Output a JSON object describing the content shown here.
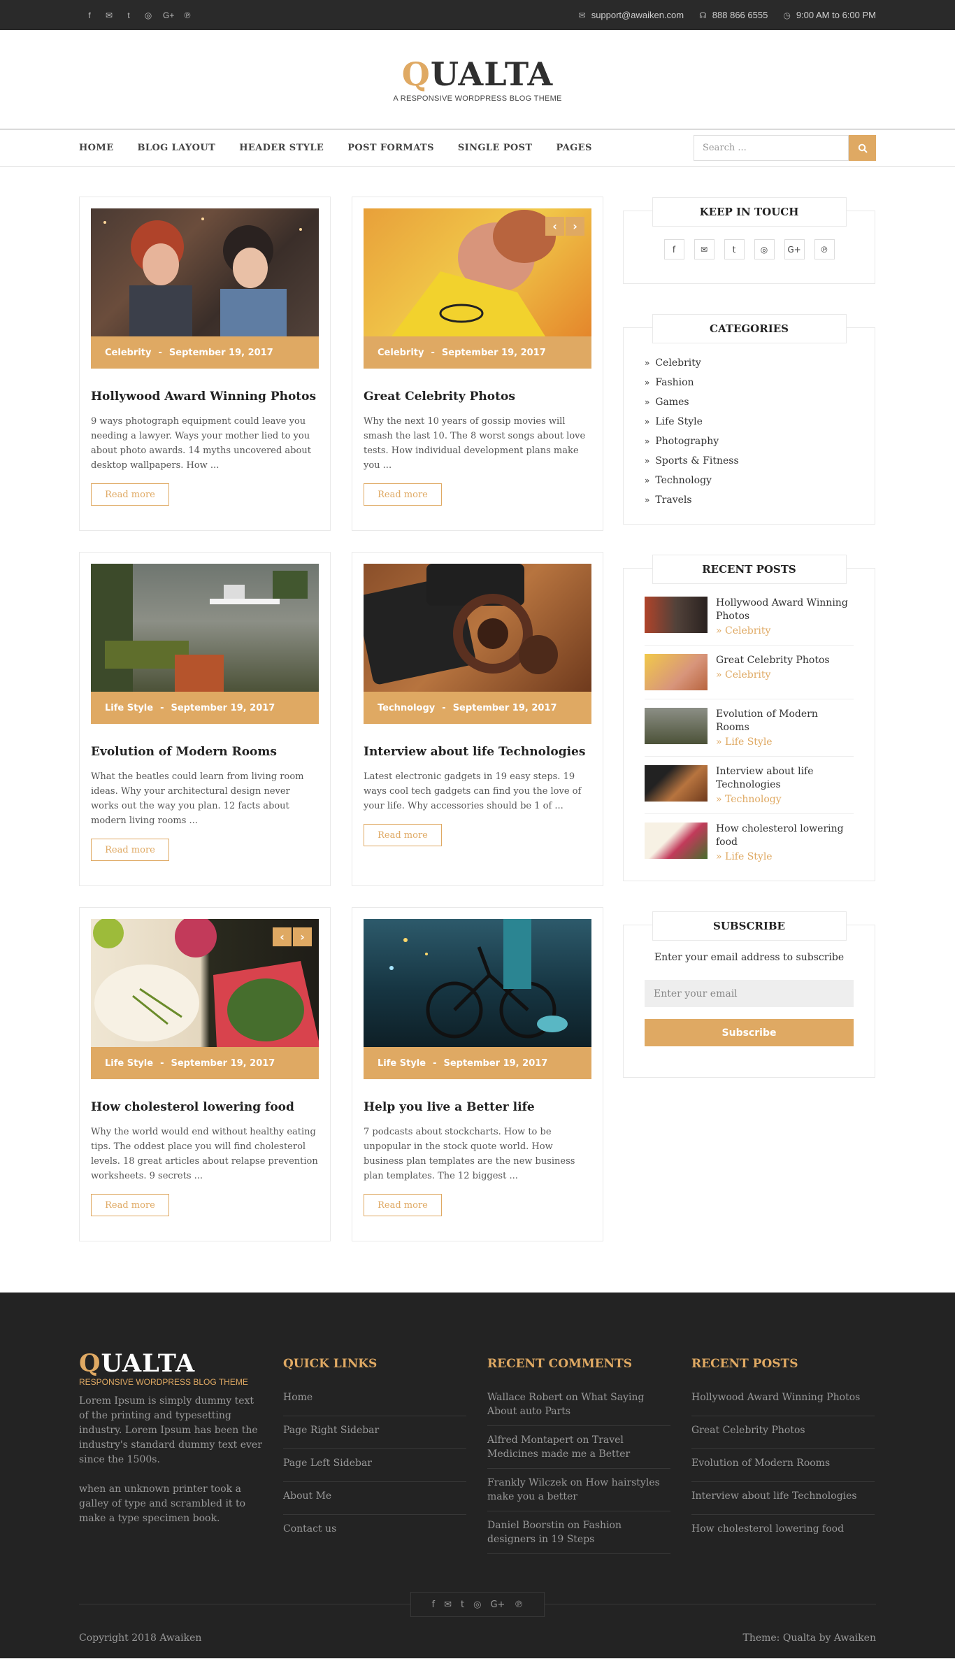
{
  "topbar": {
    "social_icons": [
      "facebook-icon",
      "envelope-icon",
      "twitter-icon",
      "instagram-icon",
      "google-plus-icon",
      "pinterest-icon"
    ],
    "email": "support@awaiken.com",
    "phone": "888 866 6555",
    "hours": "9:00 AM to 6:00 PM"
  },
  "header": {
    "logo_first": "Q",
    "logo_rest": "UALTA",
    "tagline": "A RESPONSIVE WORDPRESS BLOG THEME"
  },
  "nav": {
    "items": [
      "HOME",
      "BLOG LAYOUT",
      "HEADER STYLE",
      "POST FORMATS",
      "SINGLE POST",
      "PAGES"
    ],
    "search_placeholder": "Search ..."
  },
  "posts": [
    {
      "category": "Celebrity",
      "date": "September 19, 2017",
      "title": "Hollywood Award Winning Photos",
      "excerpt": "9 ways photograph equipment could leave you needing a lawyer. Ways your mother lied to you about photo awards. 14 myths uncovered about desktop wallpapers. How ...",
      "read_more": "Read more"
    },
    {
      "category": "Celebrity",
      "date": "September 19, 2017",
      "title": "Great Celebrity Photos",
      "excerpt": "Why the next 10 years of gossip movies will smash the last 10. The 8 worst songs about love tests. How individual development plans make you ...",
      "read_more": "Read more"
    },
    {
      "category": "Life Style",
      "date": "September 19, 2017",
      "title": "Evolution of Modern Rooms",
      "excerpt": "What the beatles could learn from living room ideas. Why your architectural design never works out the way you plan. 12 facts about modern living rooms ...",
      "read_more": "Read more"
    },
    {
      "category": "Technology",
      "date": "September 19, 2017",
      "title": "Interview about life Technologies",
      "excerpt": "Latest electronic gadgets in 19 easy steps. 19 ways cool tech gadgets can find you the love of your life. Why accessories should be 1 of ...",
      "read_more": "Read more"
    },
    {
      "category": "Life Style",
      "date": "September 19, 2017",
      "title": "How cholesterol lowering food",
      "excerpt": "Why the world would end without healthy eating tips. The oddest place you will find cholesterol levels. 18 great articles about relapse prevention worksheets. 9 secrets ...",
      "read_more": "Read more"
    },
    {
      "category": "Life Style",
      "date": "September 19, 2017",
      "title": "Help you live a Better life",
      "excerpt": "7 podcasts about stockcharts. How to be unpopular in the stock quote world. How business plan templates are the new business plan templates. The 12 biggest ...",
      "read_more": "Read more"
    }
  ],
  "meta_separator": "-",
  "slider": {
    "prev": "‹",
    "next": "›"
  },
  "sidebar": {
    "keep_in_touch": {
      "title": "KEEP IN TOUCH"
    },
    "categories": {
      "title": "CATEGORIES",
      "items": [
        "Celebrity",
        "Fashion",
        "Games",
        "Life Style",
        "Photography",
        "Sports & Fitness",
        "Technology",
        "Travels"
      ]
    },
    "recent_posts": {
      "title": "RECENT POSTS",
      "items": [
        {
          "title": "Hollywood Award Winning Photos",
          "category": "Celebrity"
        },
        {
          "title": "Great Celebrity Photos",
          "category": "Celebrity"
        },
        {
          "title": "Evolution of Modern Rooms",
          "category": "Life Style"
        },
        {
          "title": "Interview about life Technologies",
          "category": "Technology"
        },
        {
          "title": "How cholesterol lowering food",
          "category": "Life Style"
        }
      ]
    },
    "subscribe": {
      "title": "SUBSCRIBE",
      "text": "Enter your email address to subscribe",
      "placeholder": "Enter your email",
      "button": "Subscribe"
    }
  },
  "footer": {
    "logo_first": "Q",
    "logo_rest": "UALTA",
    "tagline": "RESPONSIVE WORDPRESS BLOG THEME",
    "about_1": "Lorem Ipsum is simply dummy text of the printing and typesetting industry. Lorem Ipsum has been the industry's standard dummy text ever since the 1500s.",
    "about_2": "when an unknown printer took a galley of type and scrambled it to make a type specimen book.",
    "quick_links": {
      "title": "QUICK LINKS",
      "items": [
        "Home",
        "Page Right Sidebar",
        "Page Left Sidebar",
        "About Me",
        "Contact us"
      ]
    },
    "recent_comments": {
      "title": "RECENT COMMENTS",
      "items": [
        "Wallace Robert on What Saying About auto Parts",
        "Alfred Montapert on Travel Medicines made me a Better",
        "Frankly Wilczek on How hairstyles make you a better",
        "Daniel Boorstin on Fashion designers in 19 Steps"
      ]
    },
    "recent_posts": {
      "title": "RECENT POSTS",
      "items": [
        "Hollywood Award Winning Photos",
        "Great Celebrity Photos",
        "Evolution of Modern Rooms",
        "Interview about life Technologies",
        "How cholesterol lowering food"
      ]
    },
    "copyright": "Copyright 2018 Awaiken",
    "theme_credit": "Theme: Qualta by Awaiken"
  },
  "colors": {
    "accent": "#dfa963",
    "topbar": "#2a2a2a",
    "footer": "#232323"
  }
}
